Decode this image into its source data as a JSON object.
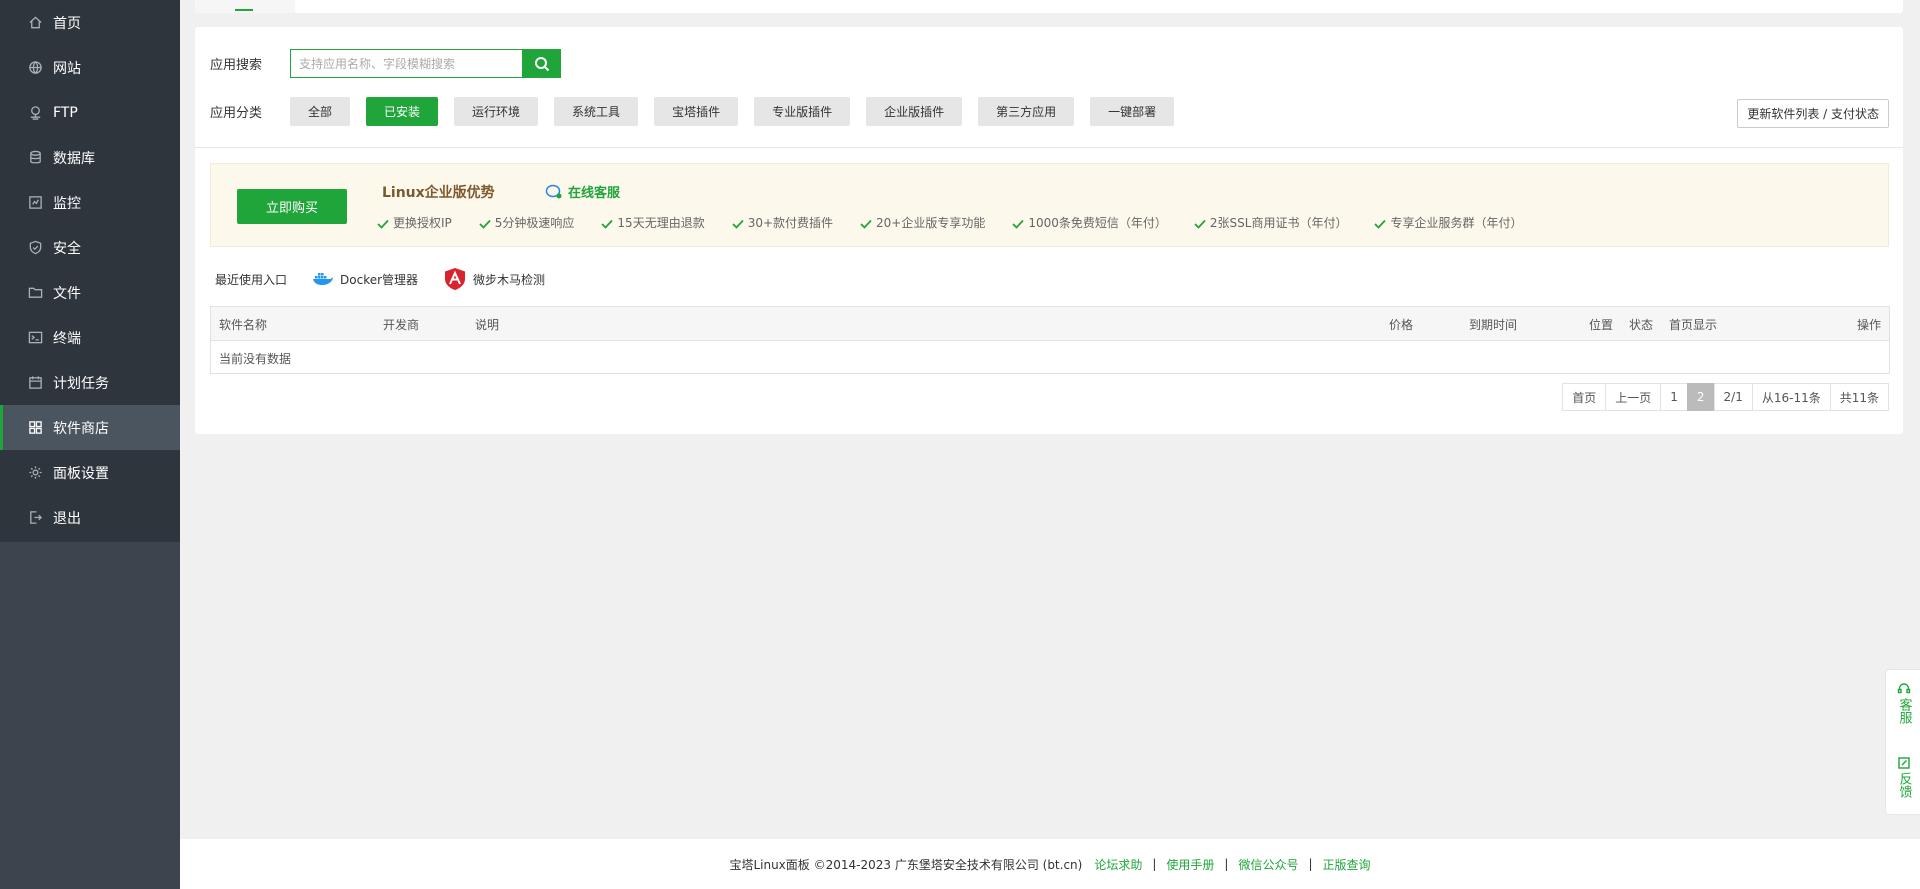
{
  "sidebar": {
    "items": [
      {
        "label": "首页",
        "icon": "home-icon"
      },
      {
        "label": "网站",
        "icon": "globe-icon"
      },
      {
        "label": "FTP",
        "icon": "ftp-icon"
      },
      {
        "label": "数据库",
        "icon": "database-icon"
      },
      {
        "label": "监控",
        "icon": "monitor-icon"
      },
      {
        "label": "安全",
        "icon": "shield-icon"
      },
      {
        "label": "文件",
        "icon": "folder-icon"
      },
      {
        "label": "终端",
        "icon": "terminal-icon"
      },
      {
        "label": "计划任务",
        "icon": "calendar-icon"
      },
      {
        "label": "软件商店",
        "icon": "apps-icon",
        "active": true
      },
      {
        "label": "面板设置",
        "icon": "gear-icon"
      },
      {
        "label": "退出",
        "icon": "logout-icon"
      }
    ]
  },
  "search": {
    "label": "应用搜索",
    "placeholder": "支持应用名称、字段模糊搜索"
  },
  "categories": {
    "label": "应用分类",
    "items": [
      "全部",
      "已安装",
      "运行环境",
      "系统工具",
      "宝塔插件",
      "专业版插件",
      "企业版插件",
      "第三方应用",
      "一键部署"
    ],
    "active": "已安装"
  },
  "update_button": "更新软件列表 / 支付状态",
  "banner": {
    "buy_label": "立即购买",
    "title": "Linux企业版优势",
    "service_label": "在线客服",
    "features": [
      "更换授权IP",
      "5分钟极速响应",
      "15天无理由退款",
      "30+款付费插件",
      "20+企业版专享功能",
      "1000条免费短信（年付）",
      "2张SSL商用证书（年付）",
      "专享企业服务群（年付）"
    ]
  },
  "recent": {
    "label": "最近使用入口",
    "items": [
      "Docker管理器",
      "微步木马检测"
    ]
  },
  "table": {
    "columns": [
      "软件名称",
      "开发商",
      "说明",
      "价格",
      "到期时间",
      "位置",
      "状态",
      "首页显示",
      "操作"
    ],
    "empty_text": "当前没有数据"
  },
  "pagination": {
    "first": "首页",
    "prev": "上一页",
    "page1": "1",
    "current": "2",
    "pages": "2/1",
    "range": "从16-11条",
    "total": "共11条"
  },
  "float": {
    "service": "客服",
    "feedback": "反馈"
  },
  "footer": {
    "copyright": "宝塔Linux面板 ©2014-2023 广东堡塔安全技术有限公司 (bt.cn)",
    "links": [
      "论坛求助",
      "使用手册",
      "微信公众号",
      "正版查询"
    ]
  },
  "colors": {
    "accent": "#20a53a",
    "sidebar_bg": "#2f353d"
  }
}
